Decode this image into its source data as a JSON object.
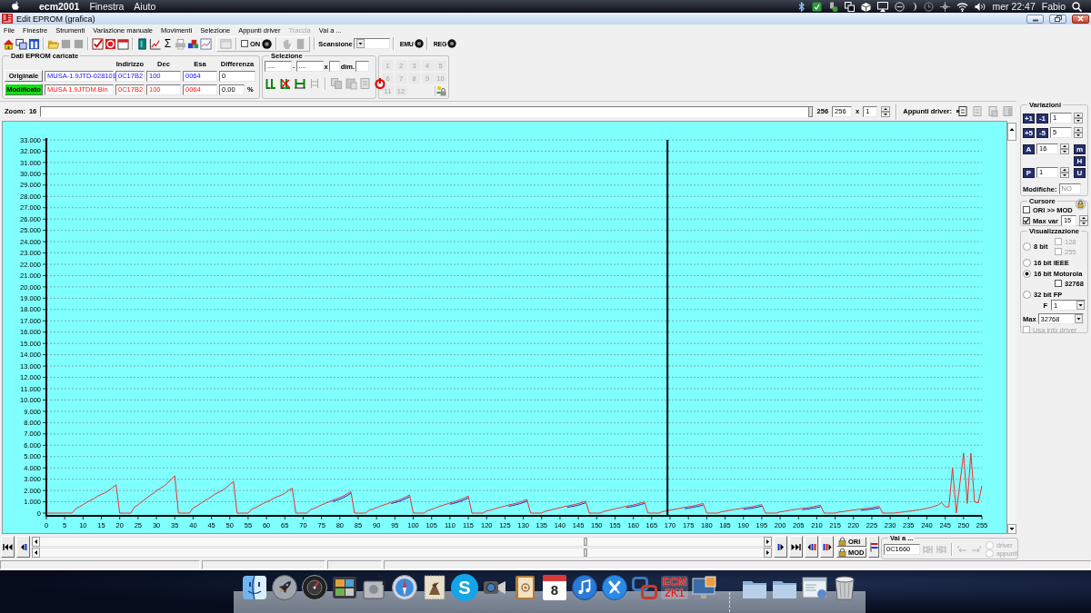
{
  "menubar": {
    "app": "ecm2001",
    "menus": [
      "Finestra",
      "Aiuto"
    ],
    "clock": "mer 22:47",
    "user": "Fabio"
  },
  "window": {
    "title": "Edit EPROM (grafica)"
  },
  "menu": [
    {
      "label": "File",
      "disabled": false
    },
    {
      "label": "Finestre",
      "disabled": false
    },
    {
      "label": "Strumenti",
      "disabled": false
    },
    {
      "label": "Variazione manuale",
      "disabled": false
    },
    {
      "label": "Movimenti",
      "disabled": false
    },
    {
      "label": "Selezione",
      "disabled": false
    },
    {
      "label": "Appunti driver",
      "disabled": false
    },
    {
      "label": "Traccia",
      "disabled": true
    },
    {
      "label": "Vai a ...",
      "disabled": false
    }
  ],
  "toolbar": {
    "sum": "Σ",
    "on": {
      "label": "ON",
      "checked": false
    },
    "scan_label": "Scansione",
    "emu": "EMU",
    "reg": "REG"
  },
  "eprom": {
    "title": "Dati EPROM caricate",
    "columns": [
      "Indirizzo",
      "Dec",
      "Esa",
      "Differenza"
    ],
    "rows": [
      {
        "kind": "original",
        "label": "Originale",
        "selected": false,
        "file": "MUSA-1.9JTD-028101",
        "address": "0C17B2",
        "dec": "100",
        "hex": "0064",
        "diff": "0"
      },
      {
        "kind": "modified",
        "label": "Modificato",
        "selected": true,
        "file": "MUSA 1.9JTDM.Bin",
        "address": "0C17B2",
        "dec": "100",
        "hex": "0064",
        "diff": "0,00",
        "unit": "%"
      }
    ]
  },
  "selection": {
    "title": "Selezione",
    "from": "....",
    "dash": "-",
    "to": "....",
    "times": "x",
    "dim": "dim."
  },
  "slots": [
    {
      "label": "1",
      "disabled": true
    },
    {
      "label": "2",
      "disabled": true
    },
    {
      "label": "3",
      "disabled": true
    },
    {
      "label": "4",
      "disabled": true
    },
    {
      "label": "5",
      "disabled": true
    },
    {
      "label": "6",
      "disabled": true
    },
    {
      "label": "7",
      "disabled": true
    },
    {
      "label": "8",
      "disabled": true
    },
    {
      "label": "9",
      "disabled": true
    },
    {
      "label": "10",
      "disabled": true
    },
    {
      "label": "11",
      "disabled": true
    },
    {
      "label": "12",
      "disabled": true
    }
  ],
  "zoom": {
    "label": "Zoom:",
    "value": "16",
    "level": 1,
    "max": "256",
    "field": "256",
    "times": "x",
    "factor": "1"
  },
  "clipboard": {
    "label": "Appunti driver:"
  },
  "graph": {
    "chart_data": {
      "type": "line",
      "grid": true,
      "xlim": [
        0,
        255
      ],
      "ylim": [
        0,
        33
      ],
      "xticks": [
        0,
        5,
        10,
        15,
        20,
        25,
        30,
        35,
        40,
        45,
        50,
        55,
        60,
        65,
        70,
        75,
        80,
        85,
        90,
        95,
        100,
        105,
        110,
        115,
        120,
        125,
        130,
        135,
        140,
        145,
        150,
        155,
        160,
        165,
        170,
        175,
        180,
        185,
        190,
        195,
        200,
        205,
        210,
        215,
        220,
        225,
        230,
        235,
        240,
        245,
        250,
        255
      ],
      "yticks": [
        0,
        {
          "value": 1,
          "label": "1.000"
        },
        {
          "value": 2,
          "label": "2.000"
        },
        {
          "value": 3,
          "label": "3.000"
        },
        {
          "value": 4,
          "label": "4.000"
        },
        {
          "value": 5,
          "label": "5.000"
        },
        {
          "value": 6,
          "label": "6.000"
        },
        {
          "value": 7,
          "label": "7.000"
        },
        {
          "value": 8,
          "label": "8.000"
        },
        {
          "value": 9,
          "label": "9.000"
        },
        {
          "value": 10,
          "label": "10.000"
        },
        {
          "value": 11,
          "label": "11.000"
        },
        {
          "value": 12,
          "label": "12.000"
        },
        {
          "value": 13,
          "label": "13.000"
        },
        {
          "value": 14,
          "label": "14.000"
        },
        {
          "value": 15,
          "label": "15.000"
        },
        {
          "value": 16,
          "label": "16.000"
        },
        {
          "value": 17,
          "label": "17.000"
        },
        {
          "value": 18,
          "label": "18.000"
        },
        {
          "value": 19,
          "label": "19.000"
        },
        {
          "value": 20,
          "label": "20.000"
        },
        {
          "value": 21,
          "label": "21.000"
        },
        {
          "value": 22,
          "label": "22.000"
        },
        {
          "value": 23,
          "label": "23.000"
        },
        {
          "value": 24,
          "label": "24.000"
        },
        {
          "value": 25,
          "label": "25.000"
        },
        {
          "value": 26,
          "label": "26.000"
        },
        {
          "value": 27,
          "label": "27.000"
        },
        {
          "value": 28,
          "label": "28.000"
        },
        {
          "value": 29,
          "label": "29.000"
        },
        {
          "value": 30,
          "label": "30.000"
        },
        {
          "value": 31,
          "label": "31.000"
        },
        {
          "value": 32,
          "label": "32.000"
        },
        {
          "value": 33,
          "label": "33.000"
        }
      ],
      "x": [
        0,
        1,
        2,
        3,
        4,
        5,
        6,
        7,
        8,
        9,
        10,
        11,
        12,
        13,
        14,
        15,
        16,
        17,
        18,
        19,
        20,
        21,
        22,
        23,
        24,
        25,
        26,
        27,
        28,
        29,
        30,
        31,
        32,
        33,
        34,
        35,
        36,
        37,
        38,
        39,
        40,
        41,
        42,
        43,
        44,
        45,
        46,
        47,
        48,
        49,
        50,
        51,
        52,
        53,
        54,
        55,
        56,
        57,
        58,
        59,
        60,
        61,
        62,
        63,
        64,
        65,
        66,
        67,
        68,
        69,
        70,
        71,
        72,
        73,
        74,
        75,
        76,
        77,
        78,
        79,
        80,
        81,
        82,
        83,
        84,
        85,
        86,
        87,
        88,
        89,
        90,
        91,
        92,
        93,
        94,
        95,
        96,
        97,
        98,
        99,
        100,
        101,
        102,
        103,
        104,
        105,
        106,
        107,
        108,
        109,
        110,
        111,
        112,
        113,
        114,
        115,
        116,
        117,
        118,
        119,
        120,
        121,
        122,
        123,
        124,
        125,
        126,
        127,
        128,
        129,
        130,
        131,
        132,
        133,
        134,
        135,
        136,
        137,
        138,
        139,
        140,
        141,
        142,
        143,
        144,
        145,
        146,
        147,
        148,
        149,
        150,
        151,
        152,
        153,
        154,
        155,
        156,
        157,
        158,
        159,
        160,
        161,
        162,
        163,
        164,
        165,
        166,
        167,
        168,
        169,
        170,
        171,
        172,
        173,
        174,
        175,
        176,
        177,
        178,
        179,
        180,
        181,
        182,
        183,
        184,
        185,
        186,
        187,
        188,
        189,
        190,
        191,
        192,
        193,
        194,
        195,
        196,
        197,
        198,
        199,
        200,
        201,
        202,
        203,
        204,
        205,
        206,
        207,
        208,
        209,
        210,
        211,
        212,
        213,
        214,
        215,
        216,
        217,
        218,
        219,
        220,
        221,
        222,
        223,
        224,
        225,
        226,
        227,
        228,
        229,
        230,
        231,
        232,
        233,
        234,
        235,
        236,
        237,
        238,
        239,
        240,
        241,
        242,
        243,
        244,
        245,
        246,
        247,
        248,
        249,
        250,
        251,
        252,
        253,
        254,
        255
      ],
      "series": [
        {
          "color": "#2020e0",
          "values": [
            null,
            null,
            null,
            null,
            null,
            null,
            null,
            null,
            null,
            null,
            null,
            null,
            null,
            null,
            null,
            null,
            null,
            null,
            null,
            null,
            null,
            null,
            null,
            null,
            null,
            null,
            null,
            null,
            null,
            null,
            null,
            null,
            null,
            null,
            null,
            null,
            null,
            null,
            null,
            null,
            null,
            null,
            null,
            null,
            null,
            null,
            null,
            null,
            null,
            null,
            null,
            null,
            null,
            null,
            null,
            null,
            null,
            null,
            null,
            null,
            null,
            null,
            null,
            null,
            null,
            null,
            null,
            null,
            null,
            null,
            null,
            null,
            null,
            null,
            null,
            null,
            null,
            null,
            1.02,
            1.12,
            1.23,
            1.37,
            1.55,
            1.74,
            null,
            null,
            null,
            null,
            null,
            null,
            null,
            null,
            null,
            null,
            0.84,
            0.93,
            1.02,
            1.14,
            1.29,
            1.45,
            null,
            null,
            null,
            null,
            null,
            null,
            null,
            null,
            null,
            null,
            0.78,
            0.86,
            0.95,
            1.06,
            1.2,
            1.35,
            null,
            null,
            null,
            null,
            null,
            null,
            null,
            null,
            null,
            null,
            0.6,
            0.67,
            0.74,
            0.83,
            0.94,
            1.06,
            null,
            null,
            null,
            null,
            null,
            null,
            null,
            null,
            null,
            null,
            0.51,
            0.57,
            0.63,
            0.71,
            0.81,
            0.91,
            null,
            null,
            null,
            null,
            null,
            null,
            null,
            null,
            null,
            null,
            0.48,
            0.54,
            0.6,
            0.67,
            0.76,
            0.86,
            null,
            null,
            null,
            null,
            null,
            null,
            null,
            null,
            null,
            null,
            0.39,
            0.44,
            0.49,
            0.55,
            0.63,
            0.71,
            null,
            null,
            null,
            null,
            null,
            null,
            null,
            null,
            null,
            null,
            0.33,
            0.38,
            0.42,
            0.47,
            0.54,
            0.61,
            null,
            null,
            null,
            null,
            null,
            null,
            null,
            null,
            null,
            null,
            0.3,
            0.34,
            0.38,
            0.43,
            0.49,
            0.56,
            null,
            null,
            null,
            null,
            null,
            null,
            null,
            null,
            null,
            null,
            0.24,
            0.28,
            0.31,
            0.35,
            0.4,
            0.46,
            null,
            null,
            null,
            null,
            null,
            null,
            null,
            null,
            null,
            null,
            null,
            null,
            null,
            null,
            null,
            null,
            null,
            null,
            null,
            null,
            null,
            null,
            null,
            null,
            null,
            null,
            null,
            null
          ]
        },
        {
          "color": "#f03030",
          "values": [
            0,
            0,
            0,
            0,
            0,
            0,
            0,
            0,
            0.4,
            0.55,
            0.75,
            0.95,
            1.12,
            1.3,
            1.5,
            1.65,
            1.8,
            2,
            2.25,
            2.5,
            0,
            0,
            0,
            0,
            0.53,
            0.73,
            0.99,
            1.25,
            1.49,
            1.72,
            1.98,
            2.18,
            2.38,
            2.64,
            2.97,
            3.3,
            0,
            0,
            0,
            0,
            0.45,
            0.62,
            0.84,
            1.06,
            1.26,
            1.46,
            1.68,
            1.85,
            2.02,
            2.24,
            2.52,
            2.8,
            0,
            0,
            0,
            0,
            0.35,
            0.48,
            0.66,
            0.84,
            0.99,
            1.14,
            1.32,
            1.45,
            1.58,
            1.76,
            1.98,
            2.2,
            0,
            0,
            0,
            0,
            0.3,
            0.42,
            0.57,
            0.72,
            0.86,
            0.99,
            1.14,
            1.25,
            1.37,
            1.52,
            1.71,
            1.9,
            0,
            0,
            0,
            0,
            0.26,
            0.35,
            0.48,
            0.61,
            0.72,
            0.83,
            0.96,
            1.06,
            1.15,
            1.28,
            1.44,
            1.6,
            0,
            0,
            0,
            0,
            0.24,
            0.33,
            0.45,
            0.57,
            0.68,
            0.78,
            0.9,
            0.99,
            1.08,
            1.2,
            1.35,
            1.5,
            0,
            0,
            0,
            0,
            0.19,
            0.26,
            0.36,
            0.46,
            0.54,
            0.62,
            0.72,
            0.79,
            0.86,
            0.96,
            1.08,
            1.2,
            0,
            0,
            0,
            0,
            0.17,
            0.23,
            0.32,
            0.4,
            0.47,
            0.55,
            0.63,
            0.69,
            0.76,
            0.84,
            0.95,
            1.05,
            0,
            0,
            0,
            0,
            0.16,
            0.22,
            0.3,
            0.38,
            0.45,
            0.52,
            0.6,
            0.66,
            0.72,
            0.8,
            0.9,
            1,
            0,
            0,
            0,
            0,
            0.14,
            0.19,
            0.26,
            0.32,
            0.38,
            0.44,
            0.51,
            0.56,
            0.61,
            0.68,
            0.77,
            0.85,
            0,
            0,
            0,
            0,
            0.12,
            0.17,
            0.23,
            0.29,
            0.34,
            0.39,
            0.45,
            0.5,
            0.54,
            0.6,
            0.68,
            0.75,
            0,
            0,
            0,
            0,
            0.11,
            0.15,
            0.21,
            0.27,
            0.32,
            0.36,
            0.42,
            0.46,
            0.5,
            0.56,
            0.63,
            0.7,
            0,
            0,
            0,
            0,
            0.1,
            0.13,
            0.18,
            0.23,
            0.27,
            0.31,
            0.36,
            0.4,
            0.43,
            0.48,
            0.54,
            0.6,
            0,
            0,
            0,
            0,
            0.05,
            0.08,
            0.12,
            0.16,
            0.2,
            0.25,
            0.3,
            0.36,
            0.42,
            0.5,
            0.6,
            0.7,
            0.94,
            0.55,
            0.55,
            4,
            0,
            2.6,
            5.3,
            0.85,
            5.3,
            1,
            0.9,
            2.4
          ]
        }
      ],
      "ref_lines": [
        {
          "axis": "x",
          "value": 169.3
        }
      ]
    }
  },
  "variations": {
    "title": "Variazioni",
    "steps": [
      {
        "plus": "+1",
        "minus": "-1",
        "value": "1"
      },
      {
        "plus": "+5",
        "minus": "-5",
        "value": "5"
      }
    ],
    "zoom": {
      "key": "A",
      "value": "16"
    },
    "page": {
      "key": "P",
      "value": "1"
    },
    "side_keys": [
      "m",
      "H",
      "U"
    ],
    "changes_label": "Modifiche:",
    "changes": "NO"
  },
  "cursor": {
    "title": "Cursore",
    "options": [
      {
        "label": "ORI >> MOD",
        "checked": false
      },
      {
        "label": "Max var",
        "checked": true,
        "value": "15"
      }
    ]
  },
  "display": {
    "title": "Visualizzazione",
    "modes": [
      {
        "label": "8 bit",
        "selected": false,
        "options": [
          {
            "label": "128",
            "checked": false,
            "disabled": true
          },
          {
            "label": "255",
            "checked": false,
            "disabled": true
          }
        ]
      },
      {
        "label": "16 bit IEEE",
        "selected": false
      },
      {
        "label": "16 bit Motorola",
        "selected": true,
        "options": [
          {
            "label": "32768",
            "checked": false,
            "disabled": false
          }
        ]
      },
      {
        "label": "32 bit FP",
        "selected": false,
        "field": {
          "label": "F",
          "value": "1"
        }
      }
    ],
    "max": {
      "label": "Max",
      "value": "32768"
    },
    "driver_info": {
      "label": "Usa info driver",
      "checked": false,
      "disabled": true
    }
  },
  "navigation": {
    "ori": "ORI",
    "mod": "MOD",
    "goto": {
      "title": "Vai a ...",
      "value": "0C1660"
    },
    "sources": [
      {
        "label": "driver",
        "selected": false,
        "disabled": true
      },
      {
        "label": "appunti",
        "selected": false,
        "disabled": true
      }
    ]
  },
  "dock": {
    "items": [
      {
        "kind": "face"
      },
      {
        "kind": "rocket"
      },
      {
        "kind": "gauge"
      },
      {
        "kind": "photos"
      },
      {
        "kind": "disk"
      },
      {
        "kind": "compass"
      },
      {
        "kind": "stamp"
      },
      {
        "kind": "bubble",
        "text": "S"
      },
      {
        "kind": "camera"
      },
      {
        "kind": "book"
      },
      {
        "kind": "calendar",
        "text": "8"
      },
      {
        "kind": "music"
      },
      {
        "kind": "tools"
      },
      {
        "kind": "squares"
      },
      {
        "kind": "logo",
        "text": "ECM 2K1"
      },
      {
        "kind": "monitor"
      },
      {
        "kind": "divider"
      },
      {
        "kind": "folder"
      },
      {
        "kind": "folder"
      },
      {
        "kind": "window"
      },
      {
        "kind": "trash"
      }
    ]
  }
}
